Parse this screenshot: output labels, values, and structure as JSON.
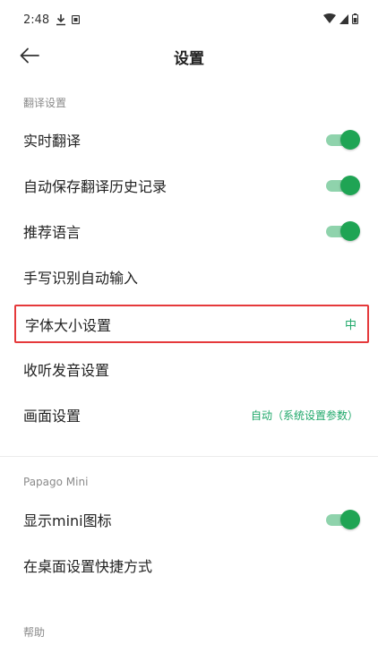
{
  "status_bar": {
    "time": "2:48"
  },
  "header": {
    "title": "设置"
  },
  "sections": {
    "translation": {
      "header": "翻译设置",
      "realtime": {
        "label": "实时翻译",
        "on": true
      },
      "autosave": {
        "label": "自动保存翻译历史记录",
        "on": true
      },
      "recommend": {
        "label": "推荐语言",
        "on": true
      },
      "handwriting": {
        "label": "手写识别自动输入"
      },
      "font_size": {
        "label": "字体大小设置",
        "value": "中"
      },
      "listen": {
        "label": "收听发音设置"
      },
      "display": {
        "label": "画面设置",
        "value": "自动（系统设置参数）"
      }
    },
    "mini": {
      "header": "Papago Mini",
      "show_icon": {
        "label": "显示mini图标",
        "on": true
      },
      "shortcut": {
        "label": "在桌面设置快捷方式"
      }
    },
    "help": {
      "header": "帮助"
    }
  },
  "colors": {
    "accent": "#1fa454",
    "highlight_border": "#e5393b"
  }
}
